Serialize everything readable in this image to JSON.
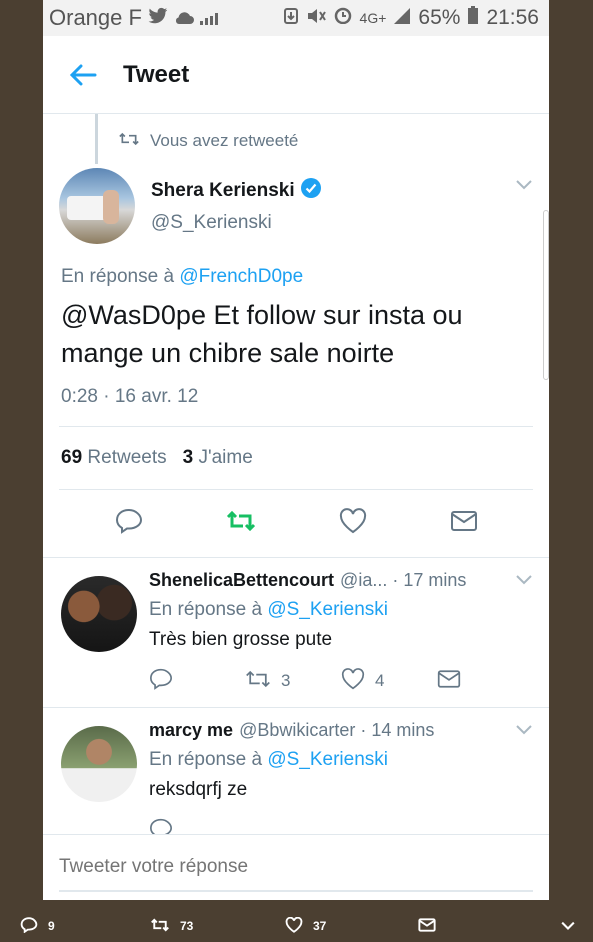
{
  "status_bar": {
    "carrier": "Orange F",
    "network": "4G+",
    "battery": "65%",
    "time": "21:56"
  },
  "header": {
    "title": "Tweet"
  },
  "tweet": {
    "retweeted_label": "Vous avez retweeté",
    "author_name": "Shera Kerienski",
    "author_handle": "@S_Kerienski",
    "reply_prefix": "En réponse à",
    "reply_to": "@FrenchD0pe",
    "text": "@WasD0pe Et follow sur insta ou mange un chibre sale noirte",
    "timestamp": "0:28 · 16 avr. 12",
    "retweets_count": "69",
    "retweets_label": "Retweets",
    "likes_count": "3",
    "likes_label": "J'aime"
  },
  "replies": [
    {
      "name": "ShenelicaBettencourt",
      "handle_time": "@ia... · 17 mins",
      "reply_prefix": "En réponse à",
      "reply_to": "@S_Kerienski",
      "text": "Très bien grosse pute",
      "retweets": "3",
      "likes": "4"
    },
    {
      "name": "marcy me",
      "handle_time": "@Bbwikicarter · 14 mins",
      "reply_prefix": "En réponse à",
      "reply_to": "@S_Kerienski",
      "text": "reksdqrfj ze"
    }
  ],
  "compose": {
    "placeholder": "Tweeter votre réponse"
  },
  "bottom_bar": {
    "replies": "9",
    "retweets": "73",
    "likes": "37"
  },
  "colors": {
    "accent": "#1da1f2",
    "retweet_active": "#17bf63",
    "muted": "#657786"
  }
}
